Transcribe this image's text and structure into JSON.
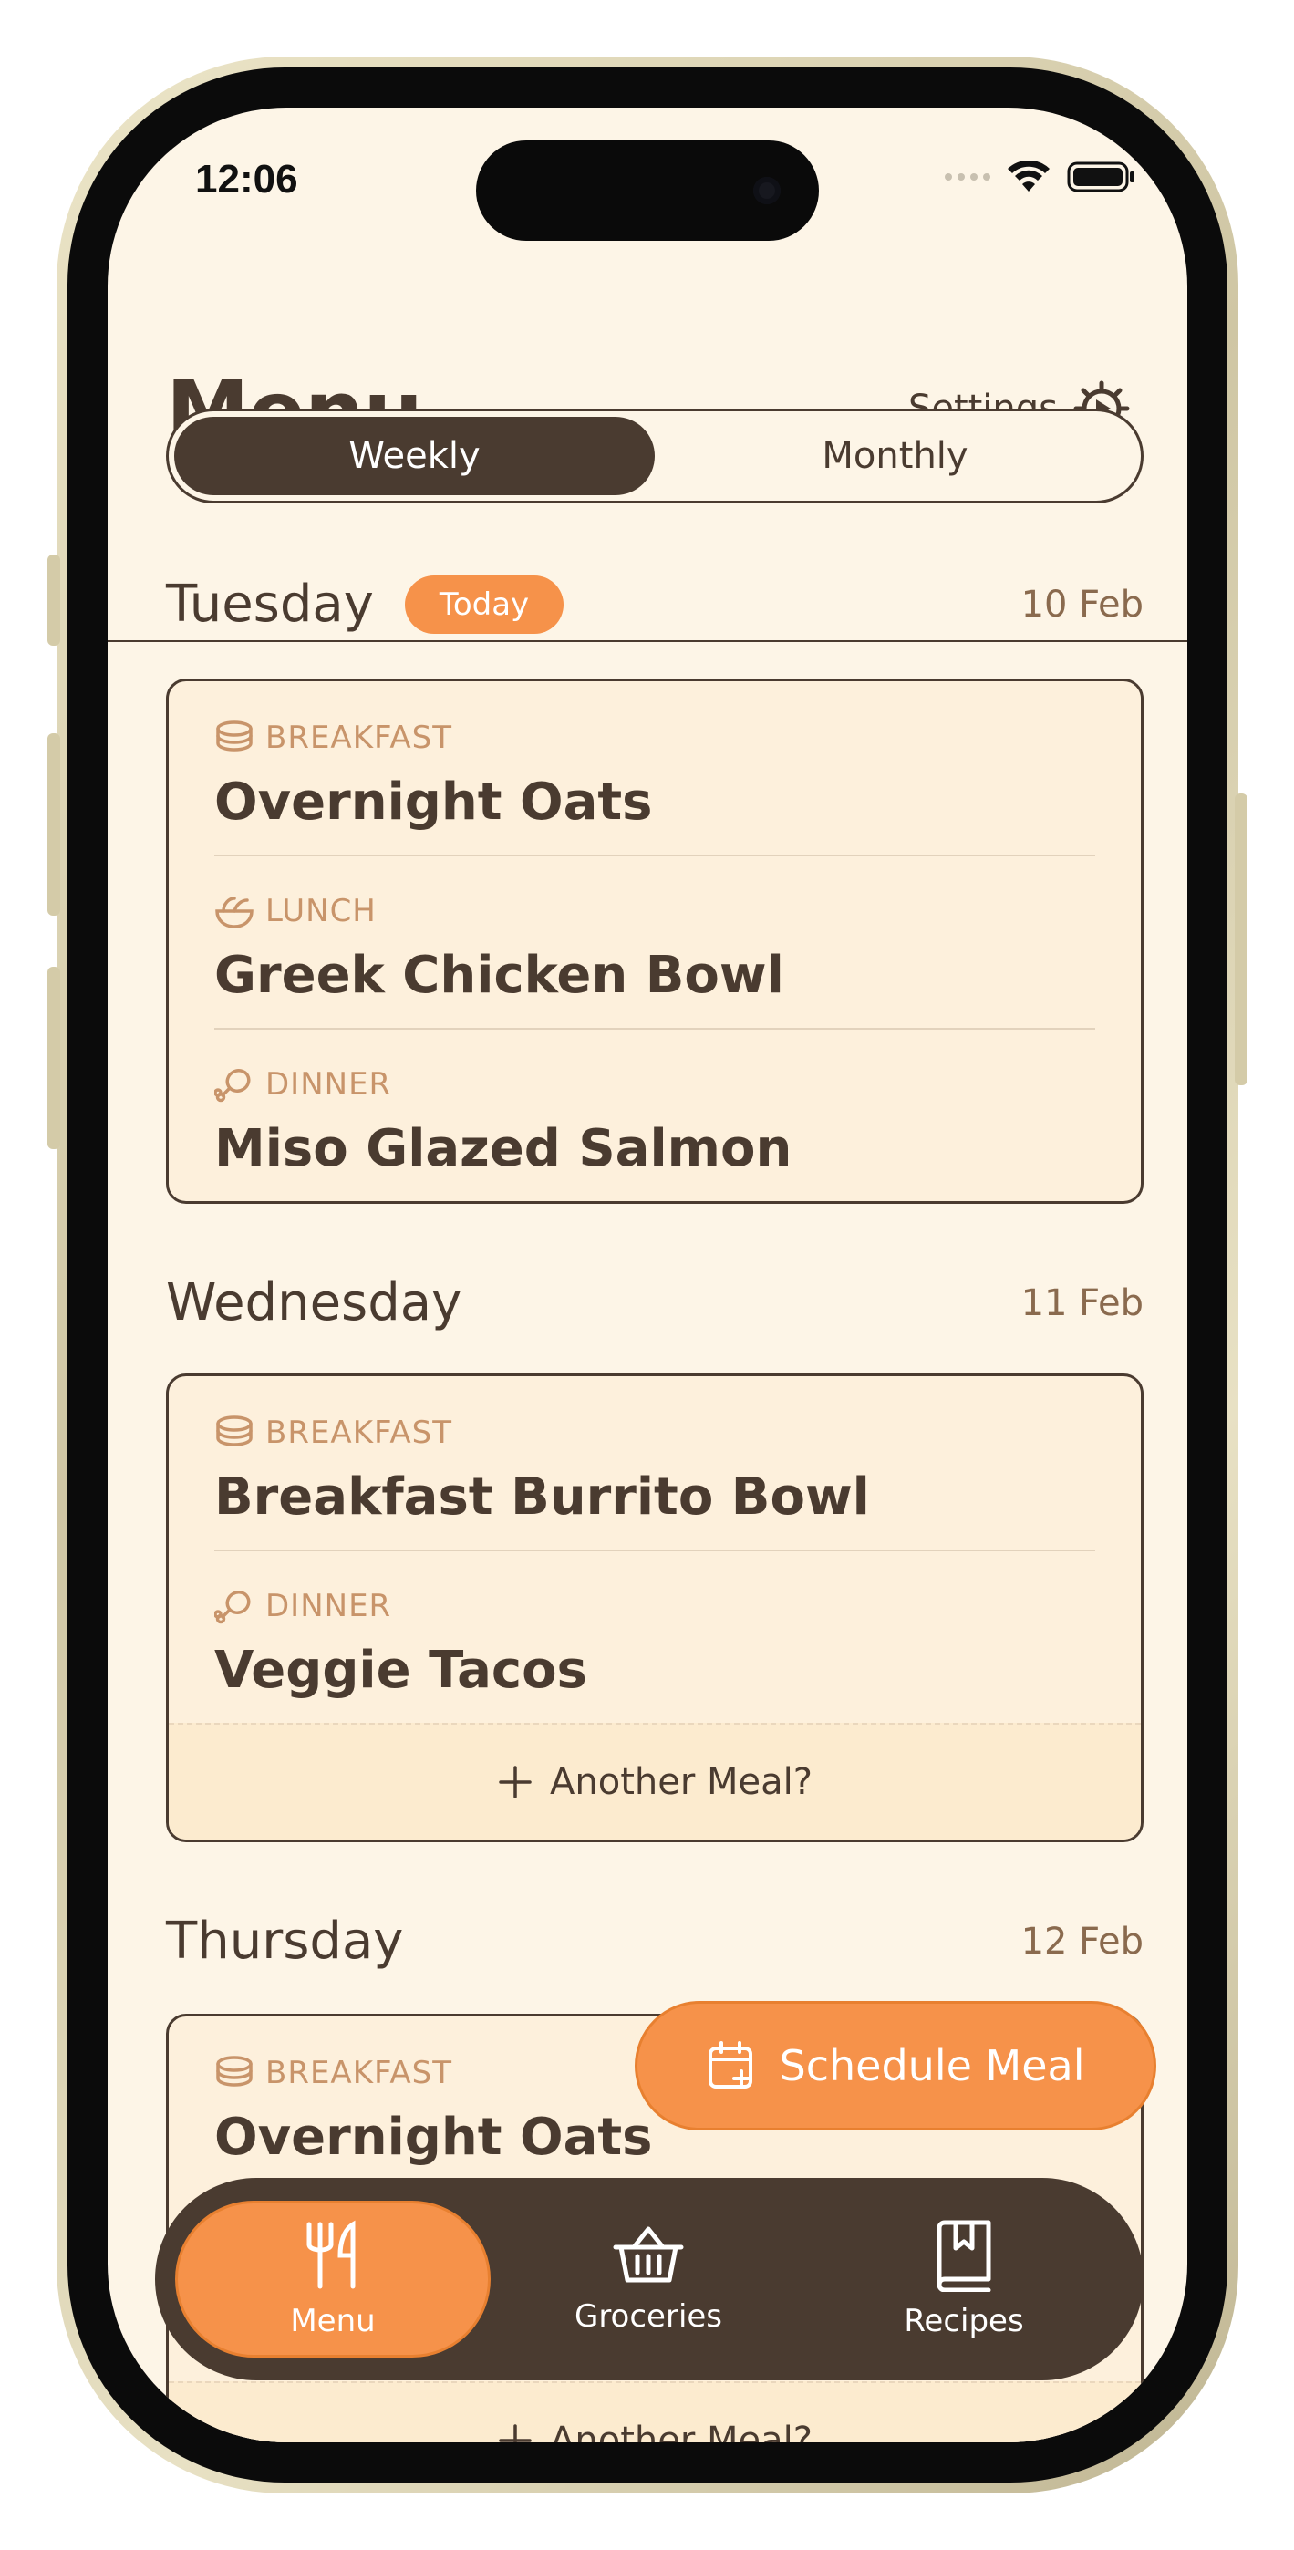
{
  "status": {
    "time": "12:06"
  },
  "header": {
    "title": "Menu",
    "settings_label": "Settings",
    "segments": [
      {
        "label": "Weekly",
        "active": true
      },
      {
        "label": "Monthly",
        "active": false
      }
    ]
  },
  "days": [
    {
      "name": "Tuesday",
      "badge": "Today",
      "date": "10 Feb",
      "meals": [
        {
          "type": "BREAKFAST",
          "icon": "pancakes-icon",
          "name": "Overnight Oats"
        },
        {
          "type": "LUNCH",
          "icon": "salad-bowl-icon",
          "name": "Greek Chicken Bowl"
        },
        {
          "type": "DINNER",
          "icon": "drumstick-icon",
          "name": "Miso Glazed Salmon"
        }
      ]
    },
    {
      "name": "Wednesday",
      "date": "11 Feb",
      "meals": [
        {
          "type": "BREAKFAST",
          "icon": "pancakes-icon",
          "name": "Breakfast Burrito Bowl"
        },
        {
          "type": "DINNER",
          "icon": "drumstick-icon",
          "name": "Veggie Tacos"
        }
      ],
      "add_label": "Another Meal?"
    },
    {
      "name": "Thursday",
      "date": "12 Feb",
      "meals": [
        {
          "type": "BREAKFAST",
          "icon": "pancakes-icon",
          "name": "Overnight Oats"
        }
      ],
      "add_label": "Another Meal?"
    }
  ],
  "fab": {
    "label": "Schedule Meal",
    "icon": "calendar-plus-icon"
  },
  "tabs": [
    {
      "label": "Menu",
      "icon": "fork-knife-icon",
      "active": true
    },
    {
      "label": "Groceries",
      "icon": "basket-icon",
      "active": false
    },
    {
      "label": "Recipes",
      "icon": "book-icon",
      "active": false
    }
  ],
  "colors": {
    "accent": "#f6924a",
    "dark": "#4a3b30",
    "background": "#fdf5e7",
    "card": "#fdf0dc",
    "label": "#c8946a"
  }
}
